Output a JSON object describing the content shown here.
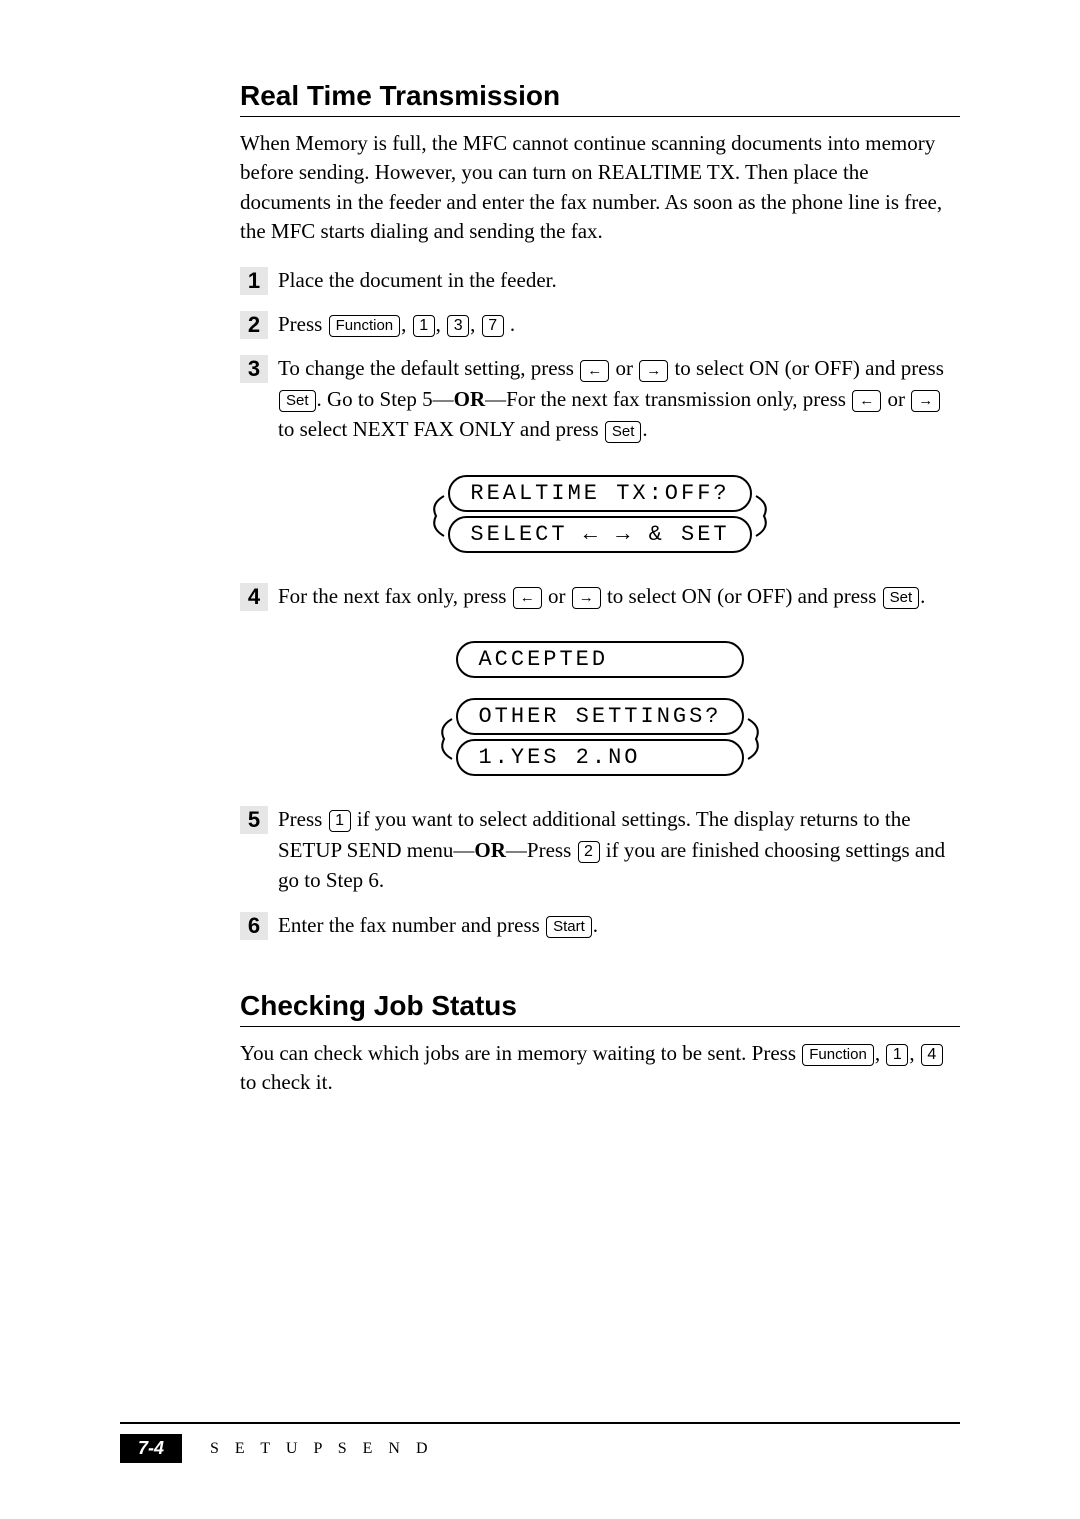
{
  "section1": {
    "title": "Real Time Transmission",
    "intro": "When Memory is full, the MFC cannot continue scanning documents into memory before sending. However, you can turn on REALTIME TX. Then place the documents in the feeder and enter the fax number. As soon as the phone line is free, the MFC starts dialing and sending the fax.",
    "steps": {
      "1": "Place the document in the feeder.",
      "2a": "Press ",
      "2b": " .",
      "3a": "To change the default setting, press ",
      "3b": " or ",
      "3c": " to select ON (or OFF) and press ",
      "3d": ". Go to Step 5—",
      "3or": "OR",
      "3e": "—For the next fax transmission only, press ",
      "3f": " or ",
      "3g": " to select NEXT FAX ONLY and press ",
      "3h": ".",
      "4a": "For the next fax only, press ",
      "4b": " or ",
      "4c": " to select ON (or OFF) and press ",
      "4d": ".",
      "5a": "Press ",
      "5b": " if you want to select additional settings. The display returns to the SETUP SEND menu—",
      "5or": "OR",
      "5c": "—Press ",
      "5d": " if you are finished choosing settings and go to Step 6.",
      "6a": "Enter the fax number and press ",
      "6b": "."
    },
    "step_nums": {
      "1": "1",
      "2": "2",
      "3": "3",
      "4": "4",
      "5": "5",
      "6": "6"
    }
  },
  "keys": {
    "function": "Function",
    "set": "Set",
    "start": "Start",
    "left": "←",
    "right": "→",
    "k1": "1",
    "k2": "2",
    "k3": "3",
    "k4": "4",
    "k7": "7"
  },
  "displays": {
    "d1_line1": "REALTIME TX:OFF?",
    "d1_line2": "SELECT ← → & SET",
    "d2_line1": "ACCEPTED",
    "d3_line1": "OTHER SETTINGS?",
    "d3_line2": "1.YES 2.NO"
  },
  "section2": {
    "title": "Checking Job Status",
    "body_a": "You can check which jobs are in memory waiting to be sent. Press ",
    "body_b": ", ",
    "body_c": ", ",
    "body_d": " to check it."
  },
  "footer": {
    "page": "7-4",
    "chapter": "S E T U P   S E N D"
  },
  "sep": ", "
}
